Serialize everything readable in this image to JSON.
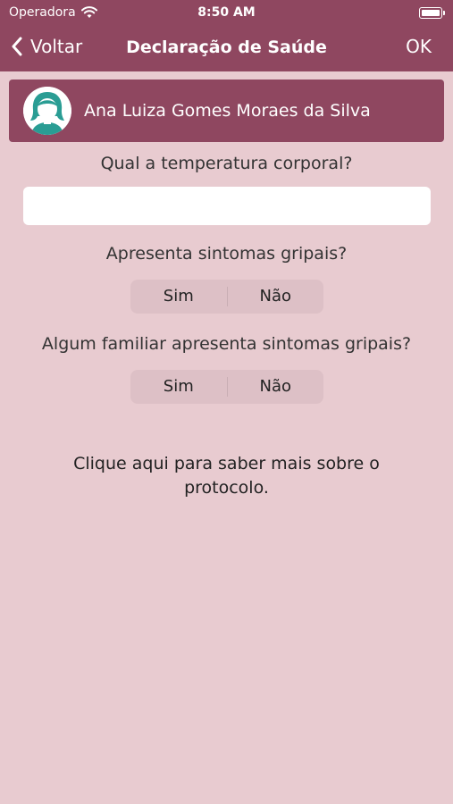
{
  "status_bar": {
    "carrier": "Operadora",
    "time": "8:50 AM",
    "icons": [
      "wifi-icon",
      "battery-icon"
    ]
  },
  "nav": {
    "back_label": "Voltar",
    "title": "Declaração de Saúde",
    "ok_label": "OK"
  },
  "profile": {
    "name": "Ana Luiza Gomes Moraes da Silva",
    "avatar_icon": "girl-avatar-icon"
  },
  "questions": {
    "temperature": {
      "label": "Qual a temperatura corporal?",
      "value": "",
      "placeholder": ""
    },
    "flu_symptoms": {
      "label": "Apresenta sintomas gripais?",
      "options": [
        "Sim",
        "Não"
      ]
    },
    "family_symptoms": {
      "label": "Algum familiar apresenta sintomas gripais?",
      "options": [
        "Sim",
        "Não"
      ]
    }
  },
  "info_link": "Clique aqui para saber mais sobre o protocolo.",
  "colors": {
    "primary": "#8f4760",
    "background": "#e8cbd0",
    "segment_background": "#ddc0c6",
    "avatar_teal": "#2a9d94"
  }
}
